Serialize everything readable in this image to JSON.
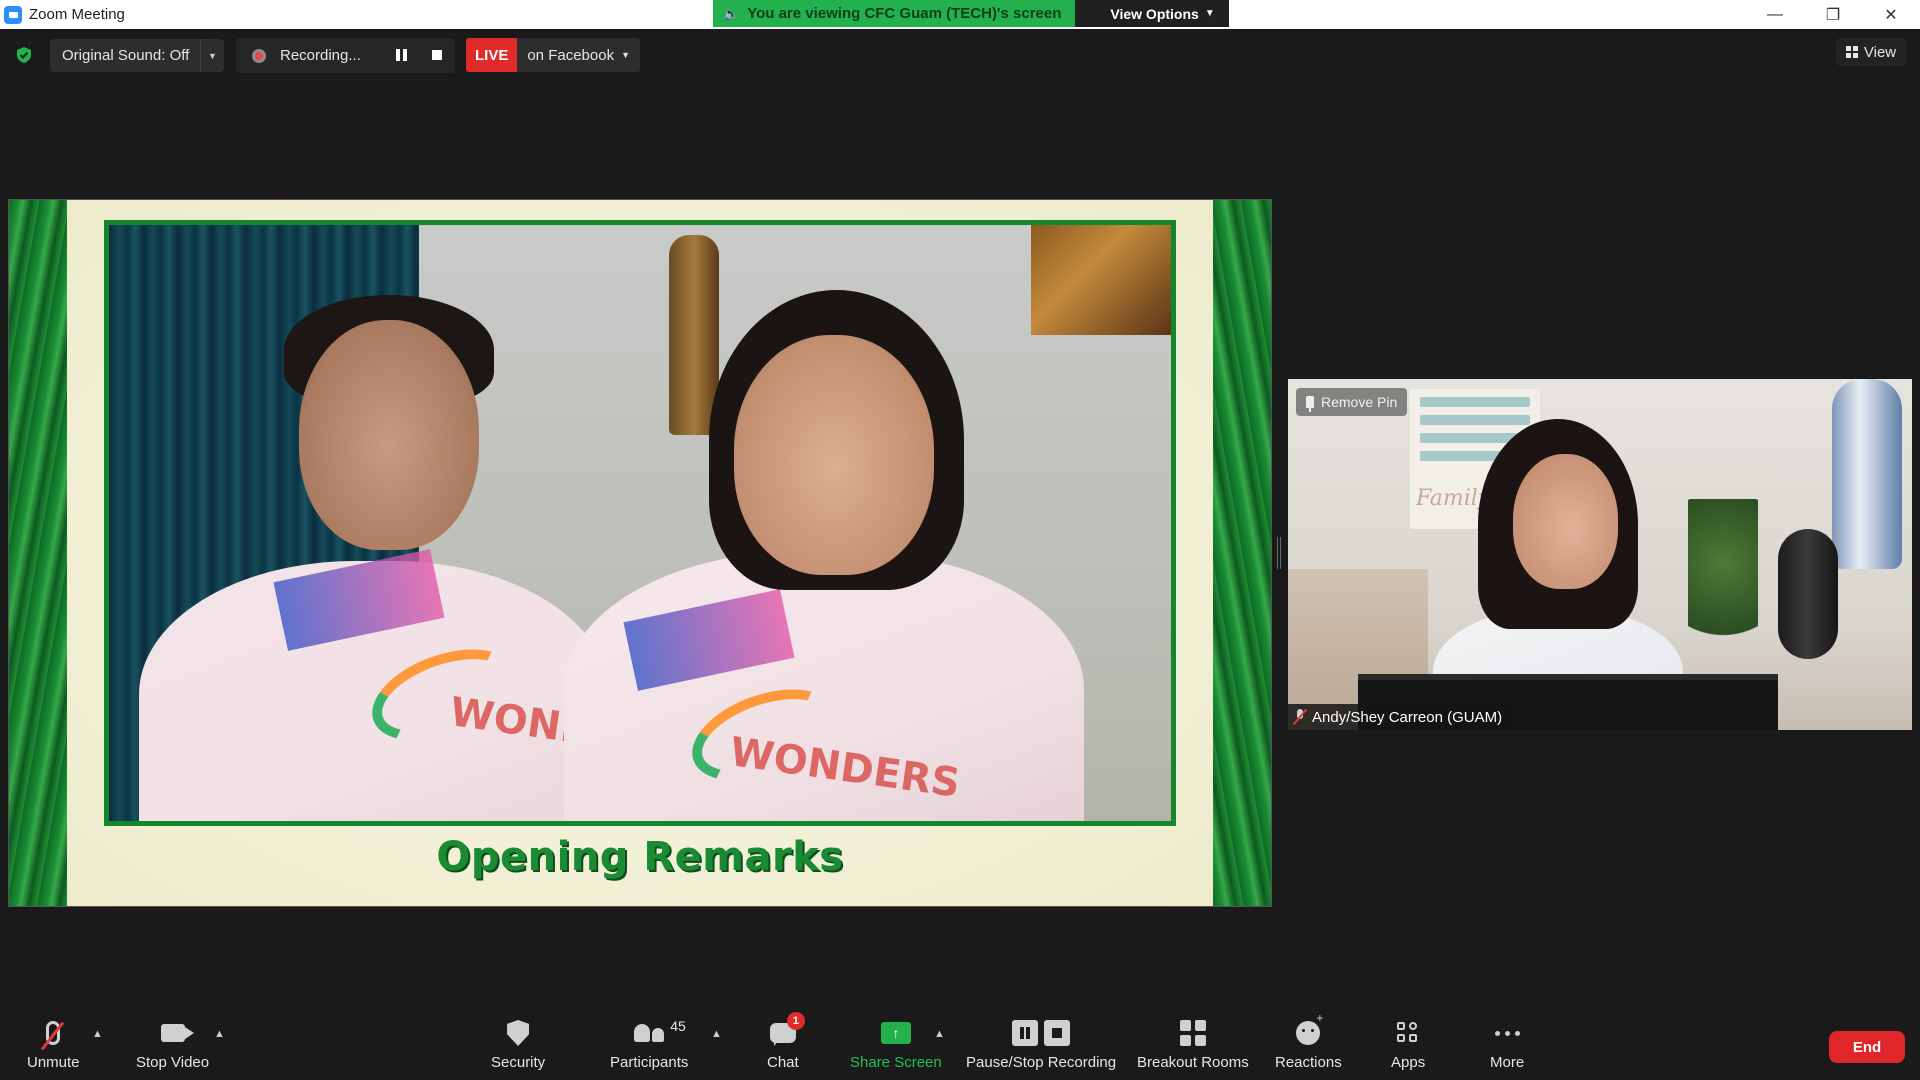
{
  "window": {
    "title": "Zoom Meeting",
    "controls": [
      "minimize-icon",
      "restore-icon",
      "close-icon"
    ]
  },
  "banner": {
    "message": "You are viewing CFC Guam (TECH)'s screen",
    "view_options": "View Options"
  },
  "top_toolbar": {
    "original_sound": "Original Sound: Off",
    "recording": "Recording...",
    "live": "LIVE",
    "live_target": "on Facebook",
    "view": "View"
  },
  "shared_screen": {
    "slide_title": "Opening Remarks",
    "shirt_text_1": "WONDERS",
    "shirt_text_2": "WONDERS"
  },
  "pinned_video": {
    "remove_pin": "Remove Pin",
    "participant_name": "Andy/Shey Carreon (GUAM)",
    "sign_script": "Family Pi"
  },
  "bottom_toolbar": {
    "unmute": "Unmute",
    "stop_video": "Stop Video",
    "security": "Security",
    "participants": "Participants",
    "participants_count": "45",
    "chat": "Chat",
    "chat_badge": "1",
    "share_screen": "Share Screen",
    "pause_stop_recording": "Pause/Stop Recording",
    "breakout_rooms": "Breakout Rooms",
    "reactions": "Reactions",
    "apps": "Apps",
    "more": "More",
    "end": "End"
  },
  "colors": {
    "accent_green": "#23b14d",
    "live_red": "#e02b2b",
    "end_red": "#e0252b",
    "slide_title_green": "#1a8a33"
  }
}
